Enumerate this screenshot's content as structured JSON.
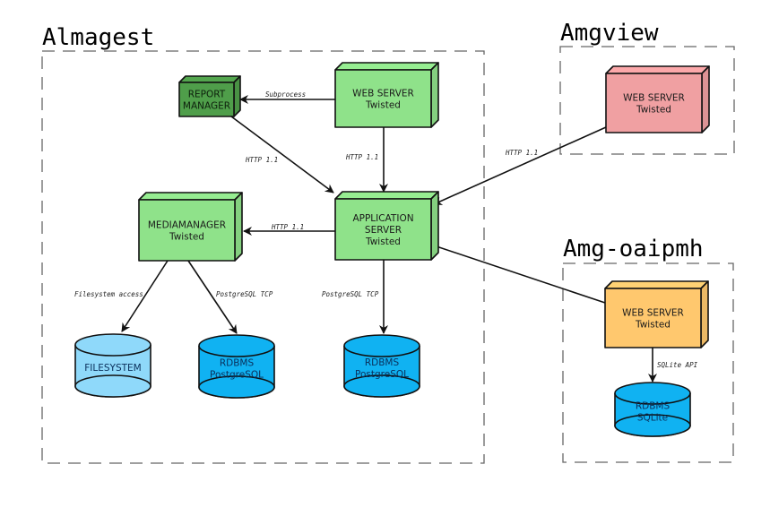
{
  "groups": [
    {
      "id": "almagest",
      "title": "Almagest"
    },
    {
      "id": "amgview",
      "title": "Amgview"
    },
    {
      "id": "amgoai",
      "title": "Amg-oaipmh"
    }
  ],
  "nodes": [
    {
      "id": "report",
      "lines": [
        "REPORT",
        "MANAGER"
      ],
      "shape": "box",
      "color": "#4f9e4a"
    },
    {
      "id": "web",
      "lines": [
        "WEB SERVER",
        "Twisted"
      ],
      "shape": "box",
      "color": "#8fe28a"
    },
    {
      "id": "app",
      "lines": [
        "APPLICATION",
        "SERVER",
        "Twisted"
      ],
      "shape": "box",
      "color": "#8fe28a"
    },
    {
      "id": "media",
      "lines": [
        "MEDIAMANAGER",
        "Twisted"
      ],
      "shape": "box",
      "color": "#8fe28a"
    },
    {
      "id": "viewweb",
      "lines": [
        "WEB SERVER",
        "Twisted"
      ],
      "shape": "box",
      "color": "#f0a0a2"
    },
    {
      "id": "oaiweb",
      "lines": [
        "WEB SERVER",
        "Twisted"
      ],
      "shape": "box",
      "color": "#ffc86e"
    },
    {
      "id": "fs",
      "lines": [
        "FILESYSTEM"
      ],
      "shape": "cylinder",
      "color": "#8fd9fa"
    },
    {
      "id": "pg1",
      "lines": [
        "RDBMS",
        "PostgreSQL"
      ],
      "shape": "cylinder",
      "color": "#10b2f2"
    },
    {
      "id": "pg2",
      "lines": [
        "RDBMS",
        "PostgreSQL"
      ],
      "shape": "cylinder",
      "color": "#10b2f2"
    },
    {
      "id": "sqlite",
      "lines": [
        "RDBMS",
        "SQLite"
      ],
      "shape": "cylinder",
      "color": "#10b2f2"
    }
  ],
  "edges": [
    {
      "from": "web",
      "to": "report",
      "label": "Subprocess"
    },
    {
      "from": "web",
      "to": "app",
      "label": "HTTP 1.1"
    },
    {
      "from": "report",
      "to": "app",
      "label": "HTTP 1.1"
    },
    {
      "from": "app",
      "to": "media",
      "label": "HTTP 1.1"
    },
    {
      "from": "viewweb",
      "to": "app",
      "label": "HTTP 1.1"
    },
    {
      "from": "oaiweb",
      "to": "app",
      "label": ""
    },
    {
      "from": "media",
      "to": "fs",
      "label": "Filesystem access"
    },
    {
      "from": "media",
      "to": "pg1",
      "label": "PostgreSQL TCP"
    },
    {
      "from": "app",
      "to": "pg2",
      "label": "PostgreSQL TCP"
    },
    {
      "from": "oaiweb",
      "to": "sqlite",
      "label": "SQLite API"
    }
  ]
}
